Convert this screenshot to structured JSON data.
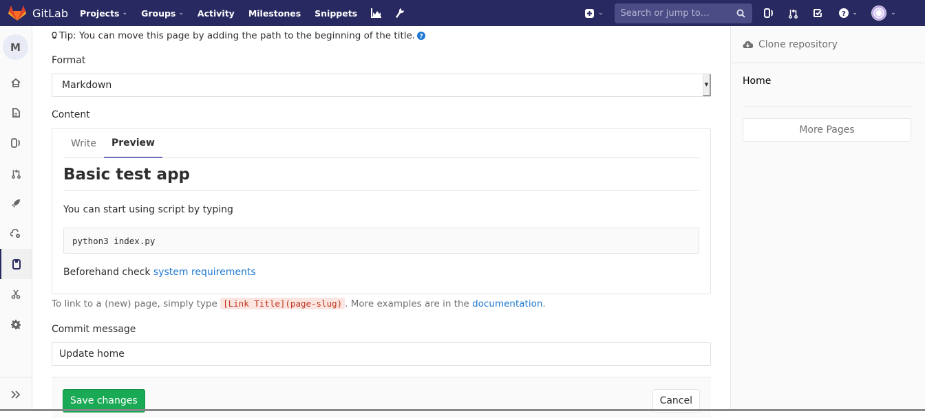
{
  "topbar": {
    "brand": "GitLab",
    "nav": [
      {
        "label": "Projects",
        "dropdown": true
      },
      {
        "label": "Groups",
        "dropdown": true
      },
      {
        "label": "Activity",
        "dropdown": false
      },
      {
        "label": "Milestones",
        "dropdown": false
      },
      {
        "label": "Snippets",
        "dropdown": false
      }
    ],
    "icons": [
      "chart-icon",
      "wrench-icon"
    ],
    "search_placeholder": "Search or jump to…",
    "right_icons": [
      "plus-square-icon",
      "issues-icon",
      "merge-request-icon",
      "todo-icon",
      "help-icon",
      "user-avatar"
    ],
    "colors": {
      "bg": "#292961",
      "search_bg": "#4b4b85"
    }
  },
  "sidebar": {
    "project_initial": "M",
    "items": [
      {
        "name": "project-overview",
        "icon": "home-icon",
        "active": false
      },
      {
        "name": "repository",
        "icon": "file-icon",
        "active": false
      },
      {
        "name": "issues",
        "icon": "issues-icon",
        "active": false
      },
      {
        "name": "merge-requests",
        "icon": "merge-request-icon",
        "active": false
      },
      {
        "name": "ci-cd",
        "icon": "rocket-icon",
        "active": false
      },
      {
        "name": "operations",
        "icon": "cloud-gear-icon",
        "active": false
      },
      {
        "name": "wiki",
        "icon": "book-icon",
        "active": true
      },
      {
        "name": "snippets",
        "icon": "scissors-icon",
        "active": false
      },
      {
        "name": "settings",
        "icon": "gear-icon",
        "active": false
      }
    ],
    "collapse_icon": "double-chevron-right-icon"
  },
  "form": {
    "tip": "Tip: You can move this page by adding the path to the beginning of the title.",
    "format_label": "Format",
    "format_value": "Markdown",
    "content_label": "Content",
    "tabs": [
      {
        "label": "Write",
        "active": false
      },
      {
        "label": "Preview",
        "active": true
      }
    ],
    "preview": {
      "heading": "Basic test app",
      "paragraph": "You can start using script by typing",
      "code": "python3 index.py",
      "before_link": "Beforehand check ",
      "link_text": "system requirements"
    },
    "help": {
      "prefix": "To link to a (new) page, simply type ",
      "code": "[Link Title](page-slug)",
      "middle": ". More examples are in the ",
      "link": "documentation",
      "suffix": "."
    },
    "commit_label": "Commit message",
    "commit_value": "Update home",
    "save_label": "Save changes",
    "cancel_label": "Cancel",
    "colors": {
      "save": "#1aaa55",
      "link": "#1f78d1",
      "tab_active": "#6b6bbf"
    }
  },
  "right_sidebar": {
    "clone_label": "Clone repository",
    "pages": [
      "Home"
    ],
    "more_pages_label": "More Pages"
  }
}
